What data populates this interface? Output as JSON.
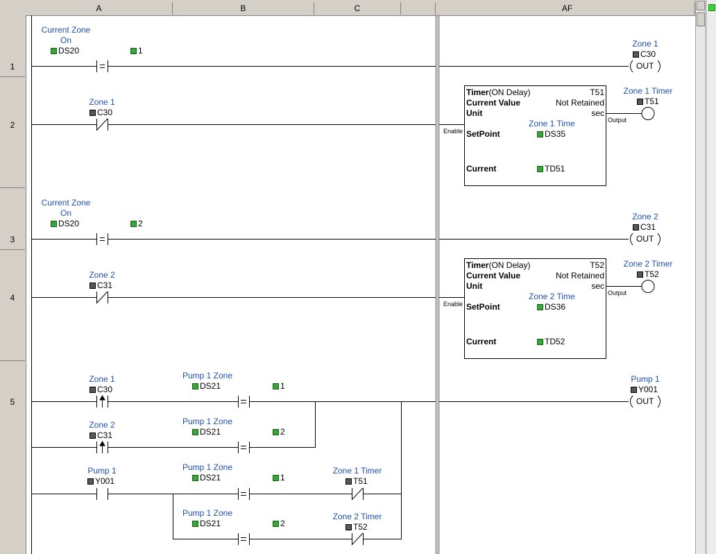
{
  "columns": [
    "A",
    "B",
    "C",
    "AF"
  ],
  "rows": [
    "1",
    "2",
    "3",
    "4",
    "5"
  ],
  "rung1": {
    "label_line1": "Current Zone",
    "label_line2": "On",
    "addr": "DS20",
    "compare_value": "1",
    "coil_label": "Zone 1",
    "coil_addr": "C30",
    "coil_text": "OUT"
  },
  "rung2": {
    "contact_label": "Zone 1",
    "contact_addr": "C30",
    "timer": {
      "title": "Timer",
      "title_suffix": "(ON Delay)",
      "number": "T51",
      "current_value_label": "Current Value",
      "retention": "Not Retained",
      "unit_label": "Unit",
      "unit": "sec",
      "setpoint_label": "SetPoint",
      "setpoint_desc": "Zone 1 Time",
      "setpoint_addr": "DS35",
      "current_label": "Current",
      "current_addr": "TD51",
      "enable": "Enable",
      "output": "Output"
    },
    "coil_label": "Zone 1 Timer",
    "coil_addr": "T51"
  },
  "rung3": {
    "label_line1": "Current Zone",
    "label_line2": "On",
    "addr": "DS20",
    "compare_value": "2",
    "coil_label": "Zone 2",
    "coil_addr": "C31",
    "coil_text": "OUT"
  },
  "rung4": {
    "contact_label": "Zone 2",
    "contact_addr": "C31",
    "timer": {
      "title": "Timer",
      "title_suffix": "(ON Delay)",
      "number": "T52",
      "current_value_label": "Current Value",
      "retention": "Not Retained",
      "unit_label": "Unit",
      "unit": "sec",
      "setpoint_label": "SetPoint",
      "setpoint_desc": "Zone 2 Time",
      "setpoint_addr": "DS36",
      "current_label": "Current",
      "current_addr": "TD52",
      "enable": "Enable",
      "output": "Output"
    },
    "coil_label": "Zone 2 Timer",
    "coil_addr": "T52"
  },
  "rung5": {
    "r1_contact_label": "Zone 1",
    "r1_contact_addr": "C30",
    "r1_cmp_label": "Pump 1 Zone",
    "r1_cmp_addr": "DS21",
    "r1_cmp_value": "1",
    "r2_contact_label": "Zone 2",
    "r2_contact_addr": "C31",
    "r2_cmp_label": "Pump 1 Zone",
    "r2_cmp_addr": "DS21",
    "r2_cmp_value": "2",
    "r3_contact_label": "Pump 1",
    "r3_contact_addr": "Y001",
    "r3_cmp_label": "Pump 1 Zone",
    "r3_cmp_addr": "DS21",
    "r3_cmp_value": "1",
    "r3_nc_label": "Zone 1 Timer",
    "r3_nc_addr": "T51",
    "r4_cmp_label": "Pump 1 Zone",
    "r4_cmp_addr": "DS21",
    "r4_cmp_value": "2",
    "r4_nc_label": "Zone 2 Timer",
    "r4_nc_addr": "T52",
    "coil_label": "Pump 1",
    "coil_addr": "Y001",
    "coil_text": "OUT"
  }
}
